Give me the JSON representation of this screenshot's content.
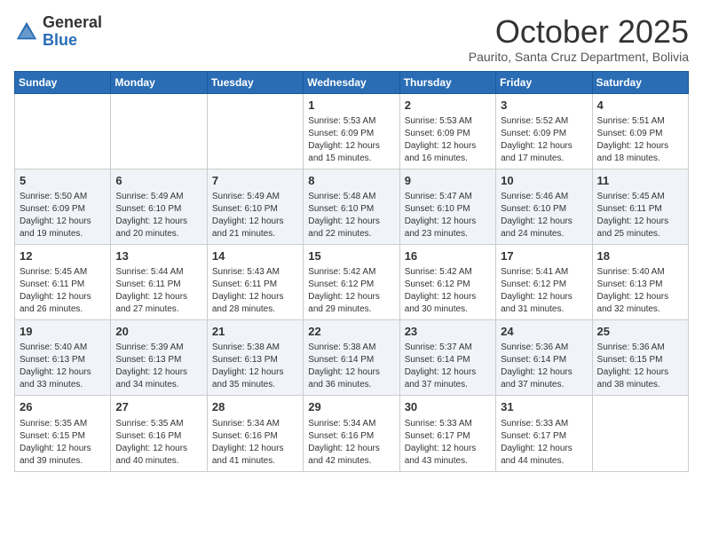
{
  "logo": {
    "general": "General",
    "blue": "Blue"
  },
  "title": "October 2025",
  "location": "Paurito, Santa Cruz Department, Bolivia",
  "days_of_week": [
    "Sunday",
    "Monday",
    "Tuesday",
    "Wednesday",
    "Thursday",
    "Friday",
    "Saturday"
  ],
  "weeks": [
    {
      "shaded": false,
      "days": [
        {
          "num": "",
          "content": ""
        },
        {
          "num": "",
          "content": ""
        },
        {
          "num": "",
          "content": ""
        },
        {
          "num": "1",
          "content": "Sunrise: 5:53 AM\nSunset: 6:09 PM\nDaylight: 12 hours\nand 15 minutes."
        },
        {
          "num": "2",
          "content": "Sunrise: 5:53 AM\nSunset: 6:09 PM\nDaylight: 12 hours\nand 16 minutes."
        },
        {
          "num": "3",
          "content": "Sunrise: 5:52 AM\nSunset: 6:09 PM\nDaylight: 12 hours\nand 17 minutes."
        },
        {
          "num": "4",
          "content": "Sunrise: 5:51 AM\nSunset: 6:09 PM\nDaylight: 12 hours\nand 18 minutes."
        }
      ]
    },
    {
      "shaded": true,
      "days": [
        {
          "num": "5",
          "content": "Sunrise: 5:50 AM\nSunset: 6:09 PM\nDaylight: 12 hours\nand 19 minutes."
        },
        {
          "num": "6",
          "content": "Sunrise: 5:49 AM\nSunset: 6:10 PM\nDaylight: 12 hours\nand 20 minutes."
        },
        {
          "num": "7",
          "content": "Sunrise: 5:49 AM\nSunset: 6:10 PM\nDaylight: 12 hours\nand 21 minutes."
        },
        {
          "num": "8",
          "content": "Sunrise: 5:48 AM\nSunset: 6:10 PM\nDaylight: 12 hours\nand 22 minutes."
        },
        {
          "num": "9",
          "content": "Sunrise: 5:47 AM\nSunset: 6:10 PM\nDaylight: 12 hours\nand 23 minutes."
        },
        {
          "num": "10",
          "content": "Sunrise: 5:46 AM\nSunset: 6:10 PM\nDaylight: 12 hours\nand 24 minutes."
        },
        {
          "num": "11",
          "content": "Sunrise: 5:45 AM\nSunset: 6:11 PM\nDaylight: 12 hours\nand 25 minutes."
        }
      ]
    },
    {
      "shaded": false,
      "days": [
        {
          "num": "12",
          "content": "Sunrise: 5:45 AM\nSunset: 6:11 PM\nDaylight: 12 hours\nand 26 minutes."
        },
        {
          "num": "13",
          "content": "Sunrise: 5:44 AM\nSunset: 6:11 PM\nDaylight: 12 hours\nand 27 minutes."
        },
        {
          "num": "14",
          "content": "Sunrise: 5:43 AM\nSunset: 6:11 PM\nDaylight: 12 hours\nand 28 minutes."
        },
        {
          "num": "15",
          "content": "Sunrise: 5:42 AM\nSunset: 6:12 PM\nDaylight: 12 hours\nand 29 minutes."
        },
        {
          "num": "16",
          "content": "Sunrise: 5:42 AM\nSunset: 6:12 PM\nDaylight: 12 hours\nand 30 minutes."
        },
        {
          "num": "17",
          "content": "Sunrise: 5:41 AM\nSunset: 6:12 PM\nDaylight: 12 hours\nand 31 minutes."
        },
        {
          "num": "18",
          "content": "Sunrise: 5:40 AM\nSunset: 6:13 PM\nDaylight: 12 hours\nand 32 minutes."
        }
      ]
    },
    {
      "shaded": true,
      "days": [
        {
          "num": "19",
          "content": "Sunrise: 5:40 AM\nSunset: 6:13 PM\nDaylight: 12 hours\nand 33 minutes."
        },
        {
          "num": "20",
          "content": "Sunrise: 5:39 AM\nSunset: 6:13 PM\nDaylight: 12 hours\nand 34 minutes."
        },
        {
          "num": "21",
          "content": "Sunrise: 5:38 AM\nSunset: 6:13 PM\nDaylight: 12 hours\nand 35 minutes."
        },
        {
          "num": "22",
          "content": "Sunrise: 5:38 AM\nSunset: 6:14 PM\nDaylight: 12 hours\nand 36 minutes."
        },
        {
          "num": "23",
          "content": "Sunrise: 5:37 AM\nSunset: 6:14 PM\nDaylight: 12 hours\nand 37 minutes."
        },
        {
          "num": "24",
          "content": "Sunrise: 5:36 AM\nSunset: 6:14 PM\nDaylight: 12 hours\nand 37 minutes."
        },
        {
          "num": "25",
          "content": "Sunrise: 5:36 AM\nSunset: 6:15 PM\nDaylight: 12 hours\nand 38 minutes."
        }
      ]
    },
    {
      "shaded": false,
      "days": [
        {
          "num": "26",
          "content": "Sunrise: 5:35 AM\nSunset: 6:15 PM\nDaylight: 12 hours\nand 39 minutes."
        },
        {
          "num": "27",
          "content": "Sunrise: 5:35 AM\nSunset: 6:16 PM\nDaylight: 12 hours\nand 40 minutes."
        },
        {
          "num": "28",
          "content": "Sunrise: 5:34 AM\nSunset: 6:16 PM\nDaylight: 12 hours\nand 41 minutes."
        },
        {
          "num": "29",
          "content": "Sunrise: 5:34 AM\nSunset: 6:16 PM\nDaylight: 12 hours\nand 42 minutes."
        },
        {
          "num": "30",
          "content": "Sunrise: 5:33 AM\nSunset: 6:17 PM\nDaylight: 12 hours\nand 43 minutes."
        },
        {
          "num": "31",
          "content": "Sunrise: 5:33 AM\nSunset: 6:17 PM\nDaylight: 12 hours\nand 44 minutes."
        },
        {
          "num": "",
          "content": ""
        }
      ]
    }
  ]
}
